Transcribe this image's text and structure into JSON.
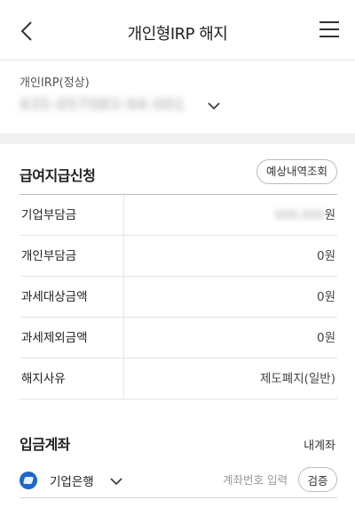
{
  "header": {
    "title": "개인형IRP 해지"
  },
  "account": {
    "label": "개인IRP(정상)",
    "number": "435-057083-94-001"
  },
  "payment": {
    "section_title": "급여지급신청",
    "preview_button": "예상내역조회",
    "rows": [
      {
        "label": "기업부담금",
        "value_masked": "000,000",
        "unit": "원"
      },
      {
        "label": "개인부담금",
        "value": "0원"
      },
      {
        "label": "과세대상금액",
        "value": "0원"
      },
      {
        "label": "과세제외금액",
        "value": "0원"
      },
      {
        "label": "해지사유",
        "value": "제도폐지(일반)"
      }
    ]
  },
  "deposit": {
    "section_title": "입금계좌",
    "my_account_link": "내계좌",
    "bank_name": "기업은행",
    "account_input_placeholder": "계좌번호 입력",
    "account_input_value": "",
    "verify_button": "검증"
  },
  "colors": {
    "bank_logo": "#1f67c8",
    "divider": "#f1f1f1"
  }
}
